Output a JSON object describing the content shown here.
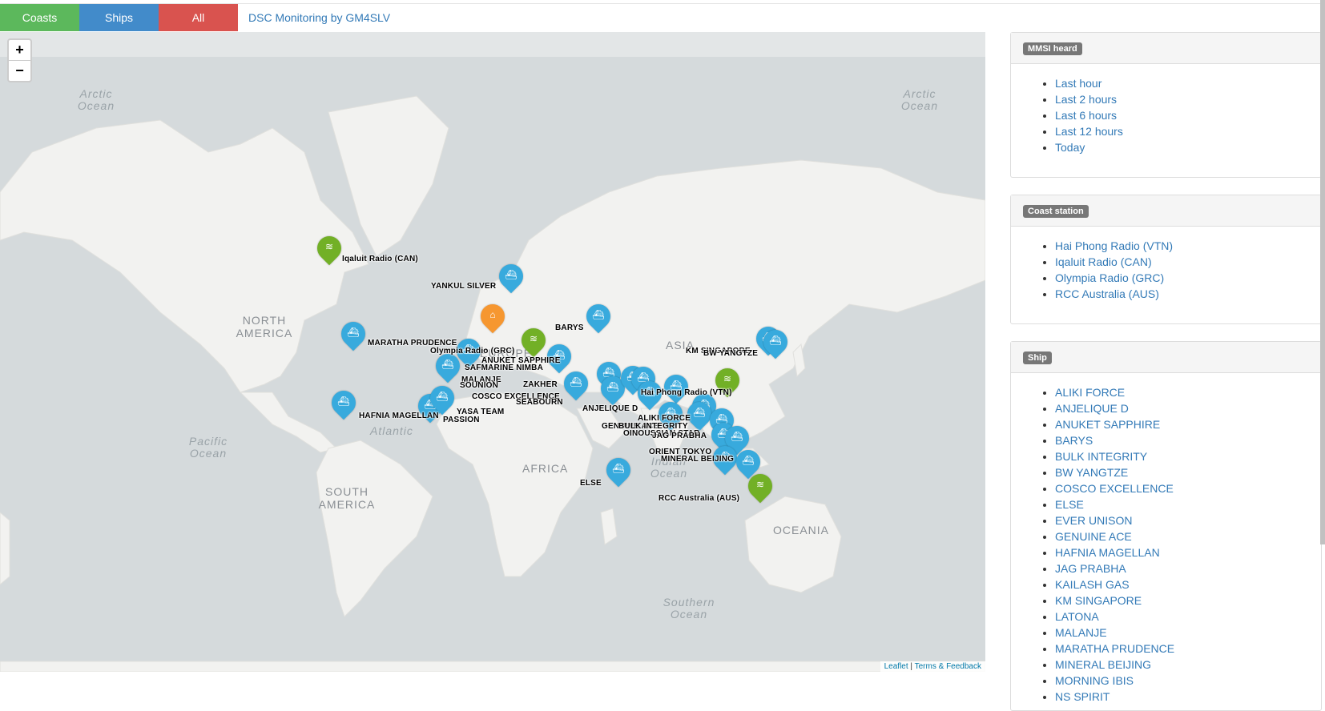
{
  "toolbar": {
    "coasts": "Coasts",
    "ships": "Ships",
    "all": "All",
    "brand": "DSC Monitoring by GM4SLV",
    "colors": {
      "coasts": "#5cb85c",
      "ships": "#428bca",
      "all": "#d9534f"
    }
  },
  "map": {
    "zoom_in": "+",
    "zoom_out": "−",
    "attribution_leaflet": "Leaflet",
    "attribution_sep": " | ",
    "attribution_terms": "Terms & Feedback",
    "regions": [
      "NORTH AMERICA",
      "SOUTH AMERICA",
      "EUROPE",
      "AFRICA",
      "ASIA",
      "OCEANIA"
    ],
    "oceans": [
      "Arctic Ocean",
      "Arctic Ocean",
      "Atlantic",
      "Pacific Ocean",
      "Indian Ocean",
      "Southern Ocean"
    ],
    "labels": [
      "Iqaluit Radio (CAN)",
      "YANKUL SILVER",
      "MARATHA PRUDENCE",
      "Olympia Radio (GRC)",
      "ANUKET SAPPHIRE",
      "SAFMARINE NIMBA",
      "BARYS",
      "MALANJE",
      "SOUNION",
      "ZAKHER",
      "COSCO EXCELLENCE",
      "SEABOURN",
      "HAFNIA MAGELLAN",
      "YASA TEAM",
      "PASSION",
      "ANJELIQUE D",
      "KM SINGAPORE",
      "BW YANGTZE",
      "ALIKI FORCE",
      "GENUINE ACE",
      "BULK INTEGRITY",
      "OINOUSSIAN STAR",
      "JAG PRABHA",
      "Hai Phong Radio (VTN)",
      "ORIENT TOKYO",
      "MINERAL BEIJING",
      "ELSE",
      "RCC Australia (AUS)"
    ],
    "marker_colors": {
      "ship": "#38aadd",
      "coast": "#72b026",
      "home": "#f69730"
    }
  },
  "panels": {
    "mmsi": {
      "title": "MMSI heard",
      "items": [
        "Last hour",
        "Last 2 hours",
        "Last 6 hours",
        "Last 12 hours",
        "Today"
      ]
    },
    "coast": {
      "title": "Coast station",
      "items": [
        "Hai Phong Radio (VTN)",
        "Iqaluit Radio (CAN)",
        "Olympia Radio (GRC)",
        "RCC Australia (AUS)"
      ]
    },
    "ship": {
      "title": "Ship",
      "items": [
        "ALIKI FORCE",
        "ANJELIQUE D",
        "ANUKET SAPPHIRE",
        "BARYS",
        "BULK INTEGRITY",
        "BW YANGTZE",
        "COSCO EXCELLENCE",
        "ELSE",
        "EVER UNISON",
        "GENUINE ACE",
        "HAFNIA MAGELLAN",
        "JAG PRABHA",
        "KAILASH GAS",
        "KM SINGAPORE",
        "LATONA",
        "MALANJE",
        "MARATHA PRUDENCE",
        "MINERAL BEIJING",
        "MORNING IBIS",
        "NS SPIRIT"
      ]
    }
  }
}
